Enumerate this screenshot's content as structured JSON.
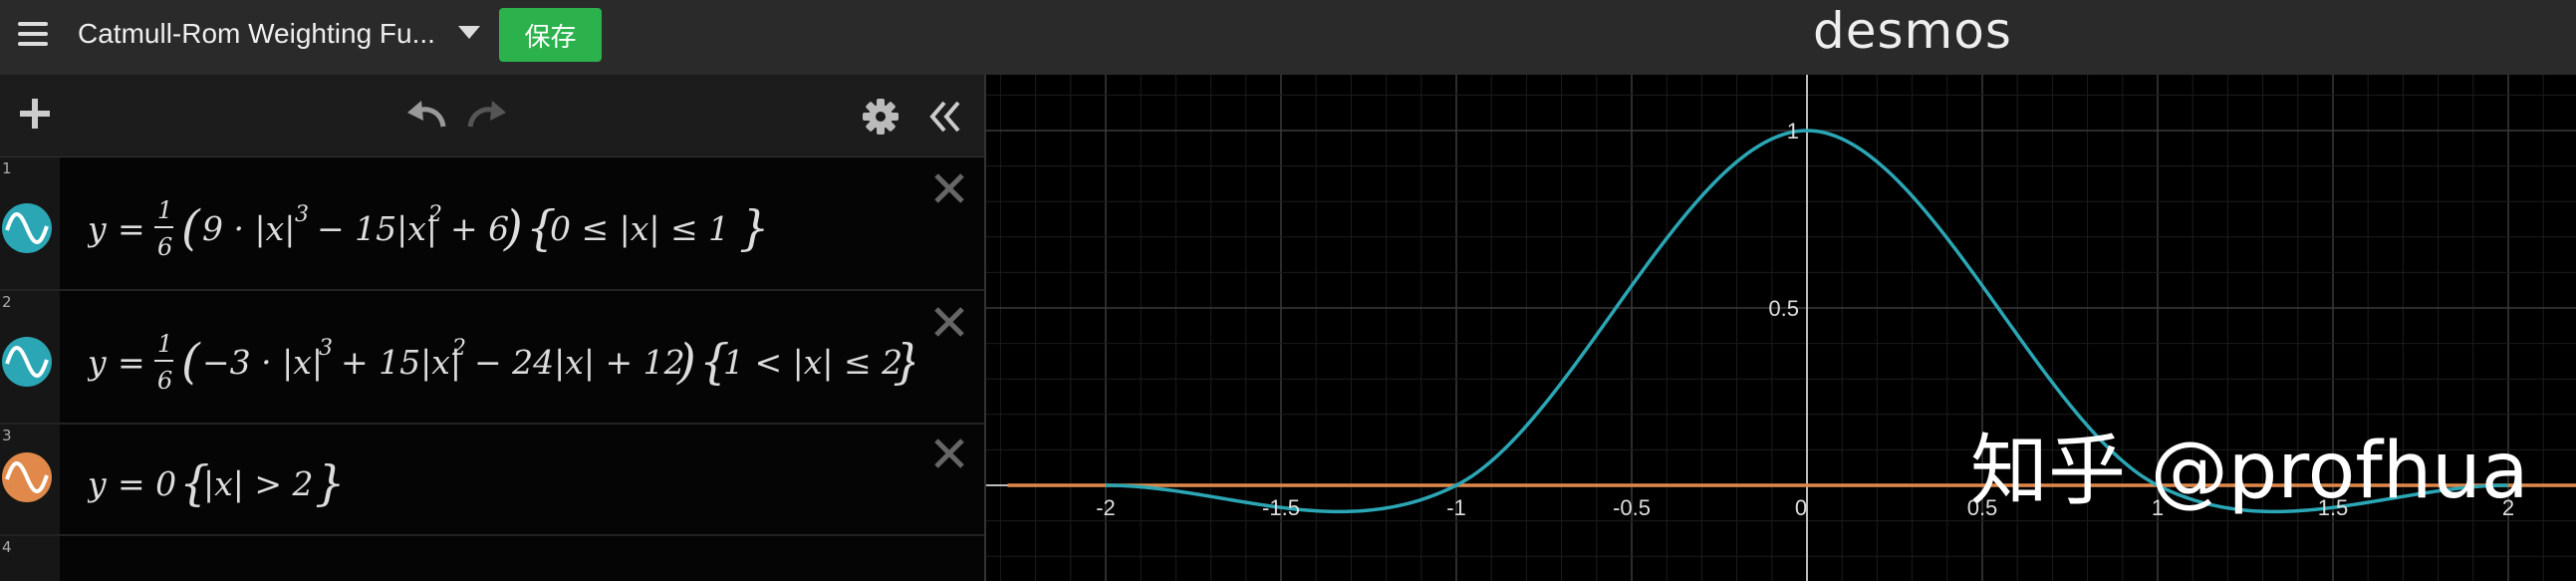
{
  "header": {
    "graph_title": "Catmull-Rom Weighting Fu...",
    "save_label": "保存",
    "brand": "desmos"
  },
  "toolbar": {
    "icons": [
      "add-icon",
      "undo-icon",
      "redo-icon",
      "settings-icon",
      "collapse-icon"
    ]
  },
  "expressions": [
    {
      "number": "1",
      "color": "#2ba6b5",
      "latex": "y = 1/6 (9·|x|³ − 15|x|² + 6) {0 ≤ |x| ≤ 1}"
    },
    {
      "number": "2",
      "color": "#2ba6b5",
      "latex": "y = 1/6 (−3·|x|³ + 15|x|² − 24|x| + 12) {1 < |x| ≤ 2}"
    },
    {
      "number": "3",
      "color": "#e0894a",
      "latex": "y = 0 {|x| > 2}"
    },
    {
      "number": "4",
      "color": "",
      "latex": ""
    }
  ],
  "chart_data": {
    "type": "line",
    "title": "",
    "xlabel": "",
    "ylabel": "",
    "xlim": [
      -2.28,
      4.2
    ],
    "ylim": [
      -0.27,
      1.1
    ],
    "x_ticks": [
      "-2",
      "-1.5",
      "-1",
      "-0.5",
      "0",
      "0.5",
      "1",
      "1.5",
      "2"
    ],
    "y_ticks": [
      "0.5",
      "1"
    ],
    "grid": true,
    "series": [
      {
        "color": "#2ba6b5",
        "x": [
          -2,
          -1.75,
          -1.5,
          -1.25,
          -1,
          -0.75,
          -0.5,
          -0.25,
          0,
          0.25,
          0.5,
          0.75,
          1,
          1.25,
          1.5,
          1.75,
          2
        ],
        "y": [
          0,
          -0.0234,
          -0.0625,
          -0.0547,
          0,
          0.2266,
          0.5625,
          0.8672,
          1,
          0.8672,
          0.5625,
          0.2266,
          0,
          -0.0547,
          -0.0625,
          -0.0234,
          0
        ]
      },
      {
        "color": "#e0894a",
        "x": [
          -2.28,
          -2,
          2,
          4.2
        ],
        "y": [
          0,
          0,
          0,
          0
        ]
      }
    ]
  },
  "watermark": "知乎 @profhua"
}
